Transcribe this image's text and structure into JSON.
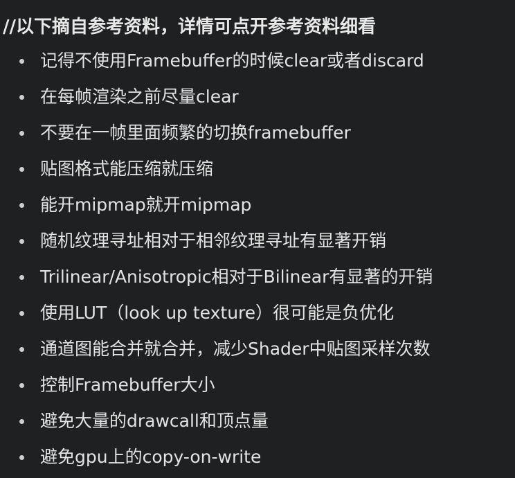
{
  "heading": "//以下摘自参考资料，详情可点开参考资料细看",
  "items": [
    "记得不使用Framebuffer的时候clear或者discard",
    "在每帧渲染之前尽量clear",
    "不要在一帧里面频繁的切换framebuffer",
    "贴图格式能压缩就压缩",
    "能开mipmap就开mipmap",
    "随机纹理寻址相对于相邻纹理寻址有显著开销",
    "Trilinear/Anisotropic相对于Bilinear有显著的开销",
    "使用LUT（look up texture）很可能是负优化",
    "通道图能合并就合并，减少Shader中贴图采样次数",
    "控制Framebuffer大小",
    "避免大量的drawcall和顶点量",
    "避免gpu上的copy-on-write"
  ]
}
